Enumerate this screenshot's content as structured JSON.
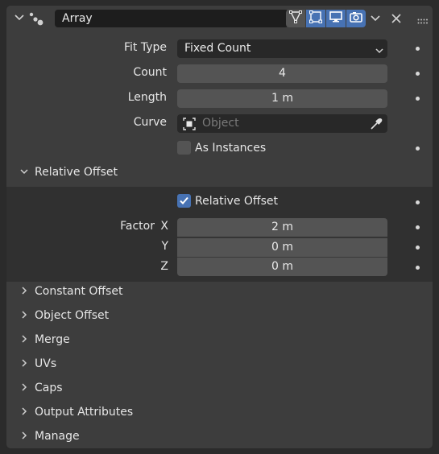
{
  "modifier": {
    "name": "Array",
    "buttons": [
      "editmode-icon",
      "cage-icon",
      "realtime-icon",
      "render-icon"
    ]
  },
  "fields": {
    "fit_type_label": "Fit Type",
    "fit_type_value": "Fixed Count",
    "count_label": "Count",
    "count_value": "4",
    "length_label": "Length",
    "length_value": "1 m",
    "curve_label": "Curve",
    "curve_placeholder": "Object",
    "as_instances_label": "As Instances",
    "as_instances_checked": false
  },
  "relative_offset": {
    "section_label": "Relative Offset",
    "enabled_label": "Relative Offset",
    "enabled_checked": true,
    "factor_label": "Factor",
    "x_label": "X",
    "y_label": "Y",
    "z_label": "Z",
    "x_value": "2 m",
    "y_value": "0 m",
    "z_value": "0 m"
  },
  "sections": [
    "Constant Offset",
    "Object Offset",
    "Merge",
    "UVs",
    "Caps",
    "Output Attributes",
    "Manage"
  ],
  "colors": {
    "accent": "#4772b3",
    "panel": "#3d3d3d",
    "field": "#545454",
    "field_dark": "#282828"
  }
}
